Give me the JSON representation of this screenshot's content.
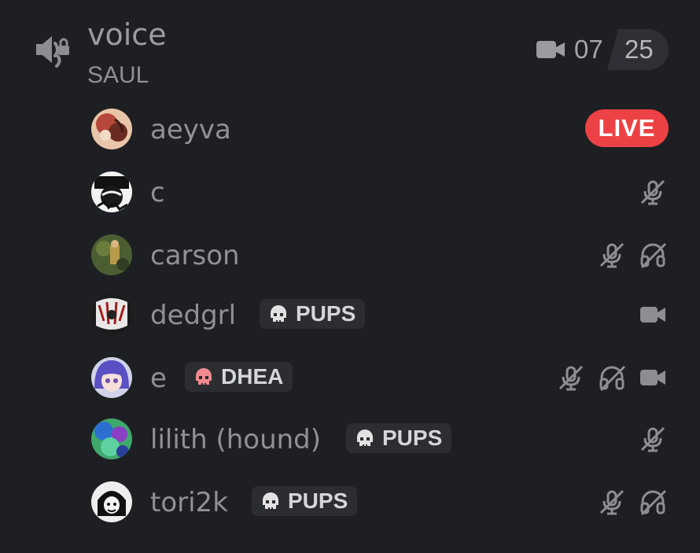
{
  "channel": {
    "name": "voice",
    "subtitle": "SAUL",
    "icon": "speaker-lock-icon",
    "camera_slots": {
      "current": "07",
      "max": "25"
    }
  },
  "users": [
    {
      "name": "aeyva",
      "status": "live",
      "live_label": "LIVE",
      "icons": []
    },
    {
      "name": "c",
      "icons": [
        "muted-mic-icon"
      ]
    },
    {
      "name": "carson",
      "icons": [
        "muted-mic-icon",
        "deafened-headphones-icon"
      ]
    },
    {
      "name": "dedgrl",
      "tag": "PUPS",
      "tag_icon": "white-skull-icon",
      "icons": [
        "video-camera-icon"
      ]
    },
    {
      "name": "e",
      "tag": "DHEA",
      "tag_icon": "red-skull-icon",
      "icons": [
        "muted-mic-icon",
        "deafened-headphones-icon",
        "video-camera-icon"
      ]
    },
    {
      "name": "lilith (hound)",
      "tag": "PUPS",
      "tag_icon": "white-skull-icon",
      "icons": [
        "muted-mic-icon"
      ]
    },
    {
      "name": "tori2k",
      "tag": "PUPS",
      "tag_icon": "white-skull-icon",
      "icons": [
        "muted-mic-icon",
        "deafened-headphones-icon"
      ]
    }
  ],
  "colors": {
    "background": "#1e1f22",
    "live": "#ed4245",
    "username": "#8f9197",
    "icon": "#8c8e94",
    "tag_bg": "#2b2d31"
  }
}
